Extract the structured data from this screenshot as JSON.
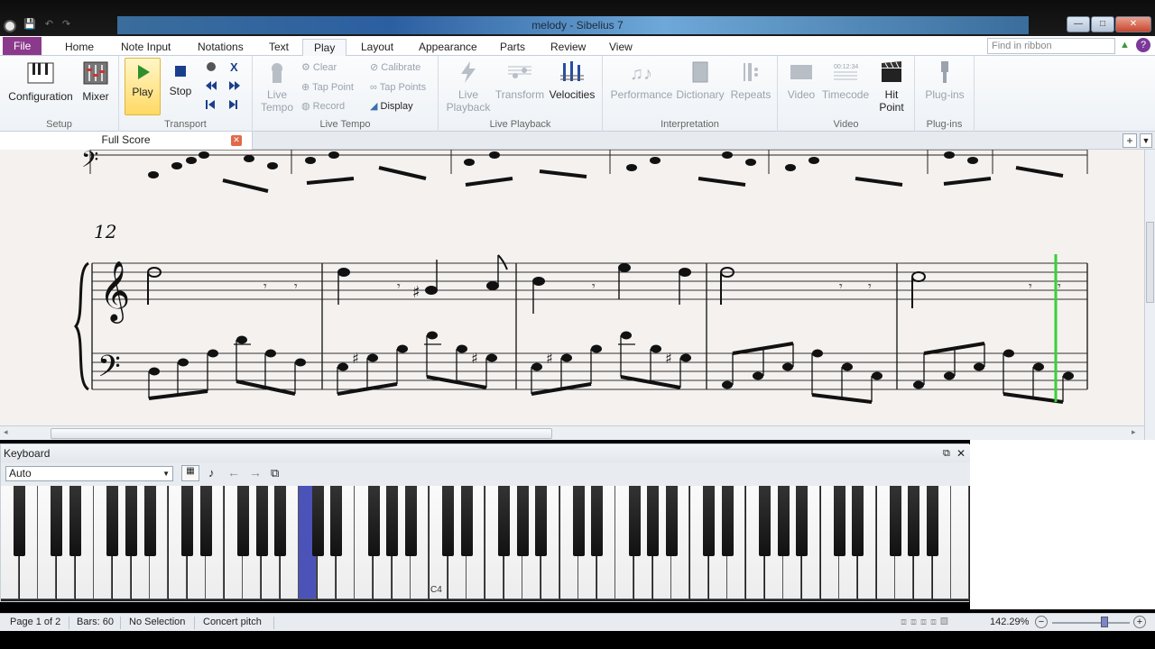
{
  "window": {
    "title": "melody - Sibelius 7",
    "buttons": {
      "minimize": "—",
      "maximize": "□",
      "close": "✕"
    }
  },
  "tabs": [
    "File",
    "Home",
    "Note Input",
    "Notations",
    "Text",
    "Play",
    "Layout",
    "Appearance",
    "Parts",
    "Review",
    "View"
  ],
  "active_tab": "Play",
  "find_placeholder": "Find in ribbon",
  "ribbon": {
    "setup": {
      "label": "Setup",
      "configuration": "Configuration",
      "mixer": "Mixer"
    },
    "transport": {
      "label": "Transport",
      "play": "Play",
      "stop": "Stop"
    },
    "live_tempo": {
      "label": "Live Tempo",
      "live_tempo_btn": "Live Tempo",
      "clear": "Clear",
      "tap_point": "Tap Point",
      "record": "Record",
      "calibrate": "Calibrate",
      "tap_points": "Tap Points",
      "display": "Display"
    },
    "live_playback": {
      "label": "Live Playback",
      "live_playback_btn": "Live Playback",
      "transform": "Transform",
      "velocities": "Velocities"
    },
    "interpretation": {
      "label": "Interpretation",
      "performance": "Performance",
      "dictionary": "Dictionary",
      "repeats": "Repeats"
    },
    "video": {
      "label": "Video",
      "video_btn": "Video",
      "timecode": "Timecode",
      "hit_point": "Hit Point"
    },
    "plugins": {
      "label": "Plug-ins",
      "plugins_btn": "Plug-ins"
    }
  },
  "document_tab": "Full Score",
  "score": {
    "bar_number": "12"
  },
  "keyboard": {
    "title": "Keyboard",
    "mode": "Auto",
    "c4_label": "C4"
  },
  "status": {
    "page": "Page 1 of 2",
    "bars": "Bars: 60",
    "selection": "No Selection",
    "pitch": "Concert pitch",
    "zoom": "142.29%"
  }
}
